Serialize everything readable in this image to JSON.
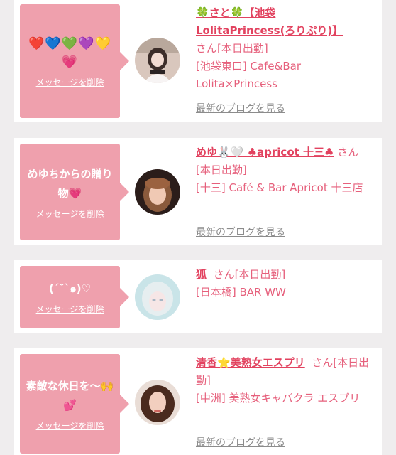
{
  "cards": [
    {
      "message": "❤️💙💚💜💛💗",
      "delete_label": "メッセージを削除",
      "name_parts": [
        "🍀さと🍀【池袋LolitaPrincess(ろりぷり)】"
      ],
      "suffix": "さん[本日出勤]",
      "shop": "[池袋東口] Cafe&Bar Lolita×Princess",
      "blog_label": "最新のブログを見る"
    },
    {
      "message": "めゆちからの贈り物💗",
      "delete_label": "メッセージを削除",
      "name_parts": [
        "めゆ🐰🤍 ♣apricot 十三♣"
      ],
      "suffix": "さん[本日出勤]",
      "shop": "[十三] Café & Bar Apricot 十三店",
      "blog_label": "最新のブログを見る"
    },
    {
      "message": "(ˊ˘ˋ๑)♡",
      "delete_label": "メッセージを削除",
      "name_parts": [
        "狐"
      ],
      "suffix": "さん[本日出勤]",
      "shop": "[日本橋] BAR WW",
      "blog_label": ""
    },
    {
      "message": "素敵な休日を〜🙌💕",
      "delete_label": "メッセージを削除",
      "name_parts": [
        "清香⭐美熟女エスプリ"
      ],
      "suffix": "さん[本日出勤]",
      "shop": "[中洲] 美熟女キャバクラ エスプリ",
      "blog_label": "最新のブログを見る"
    }
  ],
  "colors": {
    "background": "#efedee",
    "card": "#ffffff",
    "message_bubble": "#efa0ad",
    "name": "#e2425f",
    "text": "#e6607c",
    "blog_link": "#8c8c8c"
  }
}
